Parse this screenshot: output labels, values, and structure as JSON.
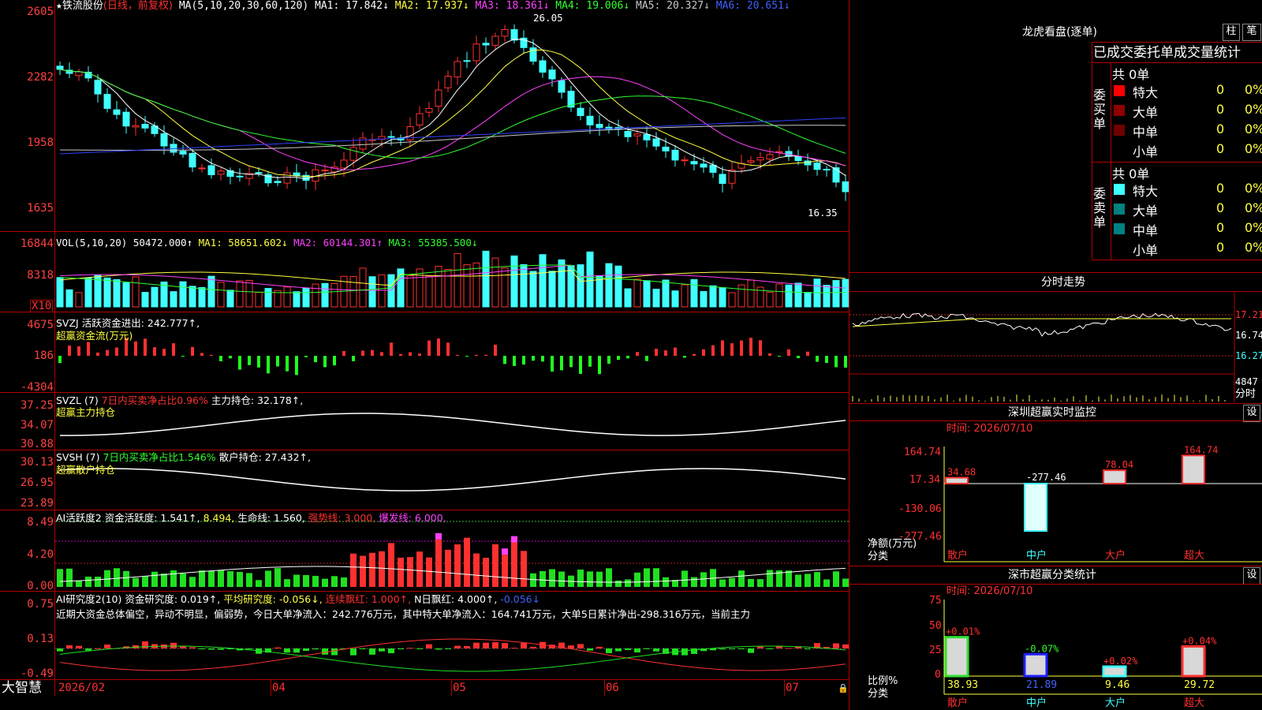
{
  "colors": {
    "up": "#ff3030",
    "down": "#40ffff",
    "ma1": "#ffffff",
    "ma2": "#ffff40",
    "ma3": "#ff40ff",
    "ma4": "#30ff30",
    "ma5": "#c8c8c8",
    "ma6": "#3040ff",
    "grid": "#b00000"
  },
  "price_panel": {
    "star": "★",
    "stock_name": "铁流股份",
    "period": "(日线，前复权)",
    "ma_params": "MA(5,10,20,30,60,120)",
    "ma1": "MA1: 17.842↓",
    "ma2": "MA2: 17.937↓",
    "ma3": "MA3: 18.361↓",
    "ma4": "MA4: 19.006↓",
    "ma5": "MA5: 20.327↓",
    "ma6": "MA6: 20.651↓",
    "y_ticks": [
      "2605",
      "2282",
      "1958",
      "1635"
    ],
    "high_marker": "26.05",
    "low_marker": "16.35"
  },
  "vol_panel": {
    "title": "VOL(5,10,20)",
    "val": "50472.000↑",
    "ma1": "MA1: 58651.602↓",
    "ma2": "MA2: 60144.301↑",
    "ma3": "MA3: 55385.500↓",
    "y_ticks": [
      "16844",
      "8318"
    ],
    "unit": "X10"
  },
  "svzj_panel": {
    "title": "SVZJ",
    "label": "活跃资金进出: 242.777↑,",
    "subtitle": "超赢资金流(万元)",
    "y_ticks": [
      "4675",
      "186",
      "-4304"
    ]
  },
  "svzl_panel": {
    "title": "SVZL (7)",
    "label1": "7日内买卖净占比0.96%",
    "label2": "主力持仓: 32.178↑,",
    "subtitle": "超赢主力持仓",
    "y_ticks": [
      "37.25",
      "34.07",
      "30.88"
    ]
  },
  "svsh_panel": {
    "title": "SVSH (7)",
    "label1": "7日内买卖净占比1.546%",
    "label2": "散户持仓: 27.432↑,",
    "subtitle": "超赢散户持仓",
    "y_ticks": [
      "30.13",
      "26.95",
      "23.89"
    ]
  },
  "ai_active_panel": {
    "title": "AI活跃度2",
    "v1": "资金活跃度: 1.541↑,",
    "v2": "8.494,",
    "v3": "生命线: 1.560,",
    "v4": "强势线: 3.000,",
    "v5": "爆发线: 6.000,",
    "y_ticks": [
      "8.49",
      "4.20",
      "0.00"
    ]
  },
  "ai_research_panel": {
    "title": "AI研究度2(10)",
    "v1": "资金研究度: 0.019↑,",
    "v2": "平均研究度: -0.056↓,",
    "v3": "连续飘红: 1.000↑,",
    "v4": "N日飘红: 4.000↑,",
    "v5": "-0.056↓",
    "comment": "近期大资金总体偏空，异动不明显，偏弱势，今日大单净流入：242.776万元，其中特大单净流入：164.741万元，大单5日累计净出-298.316万元，当前主力",
    "y_ticks": [
      "0.75",
      "0.13",
      "-0.49"
    ]
  },
  "x_axis": {
    "labels": [
      "2026/02",
      "04",
      "05",
      "06",
      "07"
    ],
    "brand": "大智慧"
  },
  "dragon": {
    "title": "龙虎看盘(逐单)",
    "btn1": "柱",
    "btn2": "笔",
    "header": "已成交委托单成交量统计",
    "buy_label": "委买单",
    "sell_label": "委卖单",
    "buy_total": "共 0单",
    "sell_total": "共 0单",
    "rows": [
      {
        "name": "特大",
        "val": "0",
        "pct": "0%"
      },
      {
        "name": "大单",
        "val": "0",
        "pct": "0%"
      },
      {
        "name": "中单",
        "val": "0",
        "pct": "0%"
      },
      {
        "name": "小单",
        "val": "0",
        "pct": "0%"
      }
    ]
  },
  "intraday": {
    "title": "分时走势",
    "y_ticks": [
      "17.21",
      "16.74",
      "16.27"
    ],
    "vol_max": "4847",
    "vol_label": "分时"
  },
  "monitor": {
    "title": "深圳超赢实时监控",
    "btn": "设",
    "time": "时间: 2026/07/10",
    "y_ticks": [
      "164.74",
      "17.34",
      "-130.06",
      "-277.46"
    ],
    "unit": "净额(万元)",
    "cat_label": "分类",
    "bars": [
      {
        "cat": "散户",
        "value": 34.68,
        "label": "34.68"
      },
      {
        "cat": "中户",
        "value": -277.46,
        "label": "-277.46"
      },
      {
        "cat": "大户",
        "value": 78.04,
        "label": "78.04"
      },
      {
        "cat": "超大",
        "value": 164.74,
        "label": "164.74"
      }
    ]
  },
  "classify": {
    "title": "深市超赢分类统计",
    "btn": "设",
    "time": "时间: 2026/07/10",
    "y_ticks": [
      "75",
      "50",
      "25",
      "0"
    ],
    "unit": "比例%",
    "cat_label": "分类",
    "bars": [
      {
        "cat": "散户",
        "value": 38.93,
        "label": "38.93",
        "chg": "+0.01%"
      },
      {
        "cat": "中户",
        "value": 21.89,
        "label": "21.89",
        "chg": "-0.07%"
      },
      {
        "cat": "大户",
        "value": 9.46,
        "label": "9.46",
        "chg": "+0.02%"
      },
      {
        "cat": "超大",
        "value": 29.72,
        "label": "29.72",
        "chg": "+0.04%"
      }
    ]
  }
}
